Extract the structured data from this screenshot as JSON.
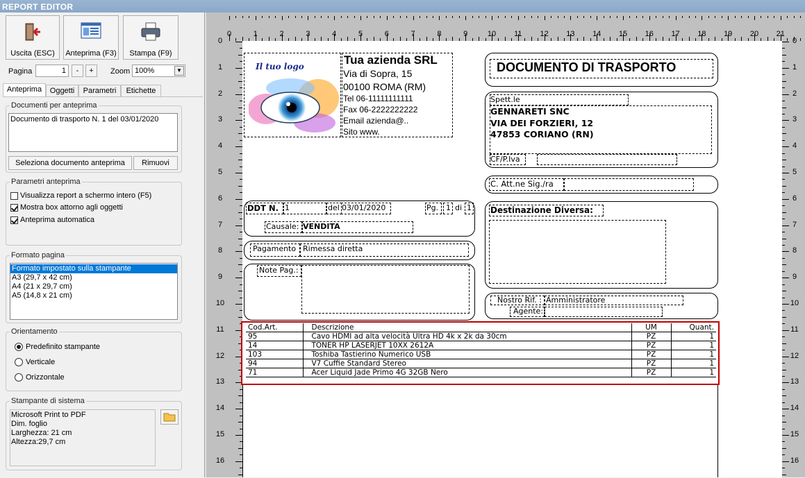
{
  "window": {
    "title": "REPORT EDITOR"
  },
  "toolbar": {
    "exit_label": "Uscita (ESC)",
    "preview_label": "Anteprima (F3)",
    "print_label": "Stampa (F9)",
    "page_label": "Pagina",
    "page_value": "1",
    "minus": "-",
    "plus": "+",
    "zoom_label": "Zoom",
    "zoom_value": "100%"
  },
  "tabs": [
    "Anteprima",
    "Oggetti",
    "Parametri",
    "Etichette"
  ],
  "docs_group": {
    "title": "Documenti per anteprima",
    "items": [
      "Documento di trasporto N. 1 del 03/01/2020"
    ],
    "select_button": "Seleziona documento anteprima",
    "remove_button": "Rimuovi"
  },
  "params_group": {
    "title": "Parametri anteprima",
    "options": [
      {
        "label": "Visualizza report a schermo intero (F5)",
        "checked": false
      },
      {
        "label": "Mostra box attorno agli oggetti",
        "checked": true
      },
      {
        "label": "Anteprima automatica",
        "checked": true
      }
    ]
  },
  "format_group": {
    "title": "Formato pagina",
    "items": [
      "Formato impostato sulla stampante",
      "A3 (29,7 x 42 cm)",
      "A4 (21 x 29,7 cm)",
      "A5 (14,8 x 21 cm)"
    ],
    "selected": "Formato impostato sulla stampante"
  },
  "orient_group": {
    "title": "Orientamento",
    "options": [
      {
        "label": "Predefinito stampante",
        "checked": true
      },
      {
        "label": "Verticale",
        "checked": false
      },
      {
        "label": "Orizzontale",
        "checked": false
      }
    ]
  },
  "printer_group": {
    "title": "Stampante di sistema",
    "lines": [
      "Microsoft Print to PDF",
      "Dim. foglio",
      "Larghezza: 21 cm",
      "Altezza:29,7 cm"
    ]
  },
  "ruler": {
    "top": [
      "0",
      "1",
      "2",
      "3",
      "4",
      "5",
      "6",
      "7",
      "8",
      "9",
      "10",
      "11",
      "12",
      "13",
      "14",
      "15",
      "16",
      "17",
      "18",
      "19",
      "20",
      "21"
    ],
    "left": [
      "0",
      "1",
      "2",
      "3",
      "4",
      "5",
      "6",
      "7",
      "8",
      "9",
      "10",
      "11",
      "12",
      "13",
      "14",
      "15",
      "16"
    ],
    "right": [
      "0",
      "1",
      "2",
      "3",
      "4",
      "5",
      "6",
      "7",
      "8",
      "9",
      "10",
      "11",
      "12",
      "13",
      "14",
      "15",
      "16"
    ]
  },
  "report": {
    "logo_text": "Il tuo logo",
    "company": {
      "name": "Tua azienda SRL",
      "address": "Via di Sopra, 15",
      "city": "00100 ROMA (RM)",
      "tel": "Tel 06-11111111111",
      "fax": "Fax 06-2222222222",
      "email": "Email azienda@..",
      "site": "Sito www."
    },
    "doc_title": "DOCUMENTO DI TRASPORTO",
    "recipient": {
      "label": "Spett.le",
      "name": "GENNARETI SNC",
      "street": "VIA DEI FORZIERI, 12",
      "city": "47853 CORIANO (RN)",
      "cf_label": "CF/P.Iva"
    },
    "attn_label": "C. Att.ne Sig./ra",
    "ddt": {
      "label": "DDT N.",
      "number": "1",
      "del_label": "del",
      "date": "03/01/2020",
      "pg_label": "Pg.",
      "pg": "1",
      "di_label": "di",
      "pg_total": "1"
    },
    "causale": {
      "label": "Causale:",
      "value": "VENDITA"
    },
    "payment": {
      "label": "Pagamento",
      "value": "Rimessa diretta"
    },
    "notes_label": "Note Pag.:",
    "destination_label": "Destinazione Diversa:",
    "nostro_rif": {
      "label": "Nostro Rif. :",
      "value": "Amministratore"
    },
    "agente_label": "Agente:",
    "table": {
      "headers": [
        "Cod.Art.",
        "Descrizione",
        "UM",
        "Quant."
      ],
      "rows": [
        [
          "95",
          "Cavo HDMI ad alta velocità Ultra HD 4k x 2k da 30cm",
          "PZ",
          "1"
        ],
        [
          "14",
          "TONER HP LASERJET 10XX 2612A",
          "PZ",
          "1"
        ],
        [
          "103",
          "Toshiba Tastierino Numerico USB",
          "PZ",
          "1"
        ],
        [
          "94",
          "V7 Cuffie Standard Stereo",
          "PZ",
          "1"
        ],
        [
          "71",
          "Acer Liquid Jade Primo 4G 32GB Nero",
          "PZ",
          "1"
        ]
      ]
    }
  },
  "colors": {
    "titlebar": "#99b4d1",
    "highlight": "#c00000",
    "selection": "#0078d7"
  },
  "icons": [
    "exit-door-icon",
    "preview-icon",
    "printer-icon",
    "folder-icon",
    "dropdown-arrow-icon"
  ]
}
